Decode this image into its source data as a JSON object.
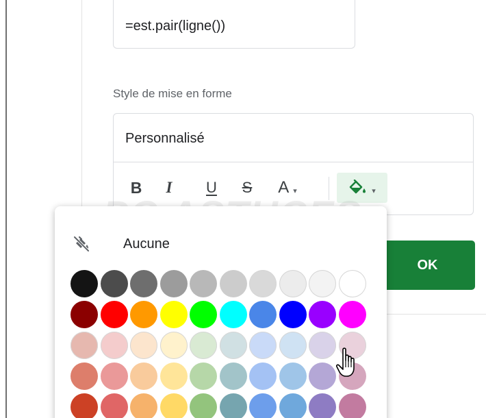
{
  "condition": {
    "formula_value": "=est.pair(ligne())"
  },
  "formatting_style": {
    "label": "Style de mise en forme",
    "preset_value": "Personnalisé",
    "toolbar": {
      "bold_label": "B",
      "italic_label": "I",
      "underline_label": "U",
      "strikethrough_label": "S",
      "text_color_label": "A",
      "text_color_caret": "▾",
      "fill_color_caret": "▾"
    }
  },
  "ok_button_label": "OK",
  "watermark_text": "PC ASTUCES",
  "fill_color_popup": {
    "none_label": "Aucune",
    "swatches": [
      [
        "#141414",
        "#4c4c4c",
        "#6e6e6e",
        "#9c9c9c",
        "#b8b8b8",
        "#cccccc",
        "#d9d9d9",
        "#ececec",
        "#f3f3f3",
        "#ffffff"
      ],
      [
        "#8b0000",
        "#ff0000",
        "#ff9900",
        "#ffff00",
        "#00ff00",
        "#00ffff",
        "#4a86e8",
        "#0000ff",
        "#9900ff",
        "#ff00ff"
      ],
      [
        "#e6b8af",
        "#f4cccc",
        "#fce5cd",
        "#fff2cc",
        "#d9ead3",
        "#d0e0e3",
        "#c9daf8",
        "#cfe2f3",
        "#d9d2e9",
        "#ead1dc"
      ],
      [
        "#dd7e6b",
        "#ea9999",
        "#f9cb9c",
        "#ffe599",
        "#b6d7a8",
        "#a2c4c9",
        "#a4c2f4",
        "#9fc5e8",
        "#b4a7d6",
        "#d5a6bd"
      ],
      [
        "#cc4125",
        "#e06666",
        "#f6b26b",
        "#ffd966",
        "#93c47d",
        "#76a5af",
        "#6d9eeb",
        "#6fa8dc",
        "#8e7cc3",
        "#c27ba0"
      ]
    ]
  }
}
